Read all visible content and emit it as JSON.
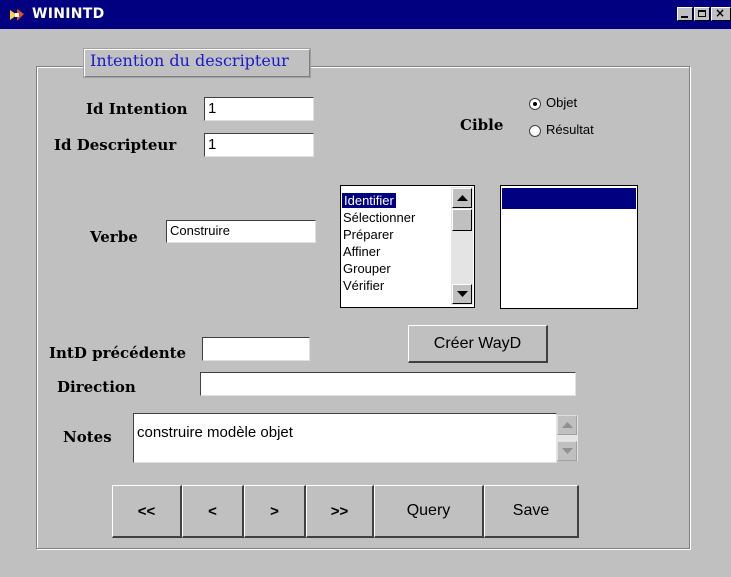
{
  "window": {
    "title": "WININTD"
  },
  "group": {
    "title": "Intention du descripteur"
  },
  "fields": {
    "id_intention": {
      "label": "Id Intention",
      "value": "1"
    },
    "id_descripteur": {
      "label": "Id Descripteur",
      "value": "1"
    },
    "verbe": {
      "label": "Verbe",
      "value": "Construire"
    },
    "intd_precedente": {
      "label": "IntD précédente",
      "value": ""
    },
    "direction": {
      "label": "Direction",
      "value": ""
    },
    "notes": {
      "label": "Notes",
      "value": "construire modèle objet"
    }
  },
  "cible": {
    "label": "Cible",
    "options": [
      "Objet",
      "Résultat"
    ],
    "selected": "Objet"
  },
  "verb_list": {
    "items": [
      "Identifier",
      "Sélectionner",
      "Préparer",
      "Affiner",
      "Grouper",
      "Vérifier"
    ],
    "selected": "Identifier"
  },
  "buttons": {
    "creer_wayd": "Créer WayD",
    "first": "<<",
    "prev": "<",
    "next": ">",
    "last": ">>",
    "query": "Query",
    "save": "Save"
  },
  "colors": {
    "titlebar": "#000080",
    "selection": "#000080",
    "group_title": "#1a1ac8",
    "face": "#c0c0c0"
  }
}
